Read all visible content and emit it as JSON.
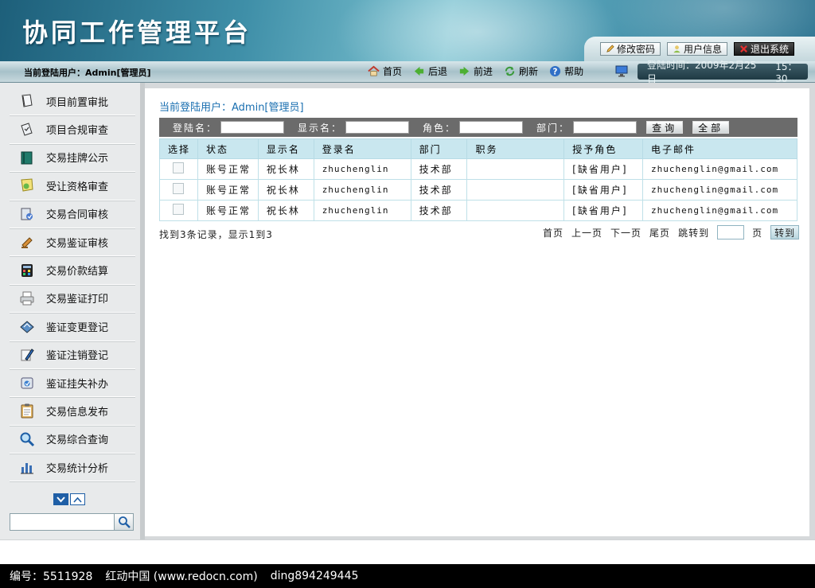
{
  "header": {
    "app_title": "协同工作管理平台",
    "actions": [
      {
        "label": "修改密码",
        "icon": "pencil-icon"
      },
      {
        "label": "用户信息",
        "icon": "user-icon"
      },
      {
        "label": "退出系统",
        "icon": "close-icon"
      }
    ]
  },
  "navbar": {
    "current_user": "当前登陆用户：Admin[管理员]",
    "items": [
      {
        "label": "首页",
        "icon": "home-icon"
      },
      {
        "label": "后退",
        "icon": "back-arrow-icon"
      },
      {
        "label": "前进",
        "icon": "forward-arrow-icon"
      },
      {
        "label": "刷新",
        "icon": "refresh-icon"
      },
      {
        "label": "帮助",
        "icon": "help-icon"
      }
    ],
    "login_time_label": "登陆时间：2009年2月25日",
    "login_time": "15：30"
  },
  "sidebar": {
    "items": [
      {
        "label": "项目前置审批",
        "icon": "document-icon"
      },
      {
        "label": "项目合规审查",
        "icon": "document-check-icon"
      },
      {
        "label": "交易挂牌公示",
        "icon": "book-icon"
      },
      {
        "label": "受让资格审查",
        "icon": "certificate-icon"
      },
      {
        "label": "交易合同审核",
        "icon": "contract-icon"
      },
      {
        "label": "交易鉴证审核",
        "icon": "stamp-icon"
      },
      {
        "label": "交易价款结算",
        "icon": "calculator-icon"
      },
      {
        "label": "交易鉴证打印",
        "icon": "printer-icon"
      },
      {
        "label": "鉴证变更登记",
        "icon": "edit-icon"
      },
      {
        "label": "鉴证注销登记",
        "icon": "pen-icon"
      },
      {
        "label": "鉴证挂失补办",
        "icon": "phone-icon"
      },
      {
        "label": "交易信息发布",
        "icon": "clipboard-icon"
      },
      {
        "label": "交易综合查询",
        "icon": "magnifier-icon"
      },
      {
        "label": "交易统计分析",
        "icon": "bar-chart-icon"
      }
    ],
    "search_placeholder": ""
  },
  "main": {
    "heading": "当前登陆用户：Admin[管理员]",
    "filters": {
      "login_name_label": "登陆名：",
      "display_name_label": "显示名：",
      "role_label": "角色：",
      "department_label": "部门：",
      "query_button": "查询",
      "all_button": "全部"
    },
    "table": {
      "headers": [
        "选择",
        "状态",
        "显示名",
        "登录名",
        "部门",
        "职务",
        "授予角色",
        "电子邮件"
      ],
      "rows": [
        {
          "status": "账号正常",
          "display_name": "祝长林",
          "login_name": "zhuchenglin",
          "department": "技术部",
          "position": "",
          "role": "[缺省用户]",
          "email": "zhuchenglin@gmail.com"
        },
        {
          "status": "账号正常",
          "display_name": "祝长林",
          "login_name": "zhuchenglin",
          "department": "技术部",
          "position": "",
          "role": "[缺省用户]",
          "email": "zhuchenglin@gmail.com"
        },
        {
          "status": "账号正常",
          "display_name": "祝长林",
          "login_name": "zhuchenglin",
          "department": "技术部",
          "position": "",
          "role": "[缺省用户]",
          "email": "zhuchenglin@gmail.com"
        }
      ]
    },
    "summary": "找到3条记录，显示1到3",
    "pager": {
      "first": "首页",
      "prev": "上一页",
      "next": "下一页",
      "last": "尾页",
      "jump_label": "跳转到",
      "page_unit": "页",
      "go": "转到"
    }
  },
  "footer": {
    "id_text": "编号：5511928",
    "site_text": "红动中国 (www.redocn.com)",
    "author_text": "ding894249445"
  },
  "colors": {
    "heading_blue": "#1a6fb0",
    "table_header_bg": "#c9e7ef",
    "filter_bar_bg": "#6b6b6b",
    "footer_bg": "#000000"
  }
}
